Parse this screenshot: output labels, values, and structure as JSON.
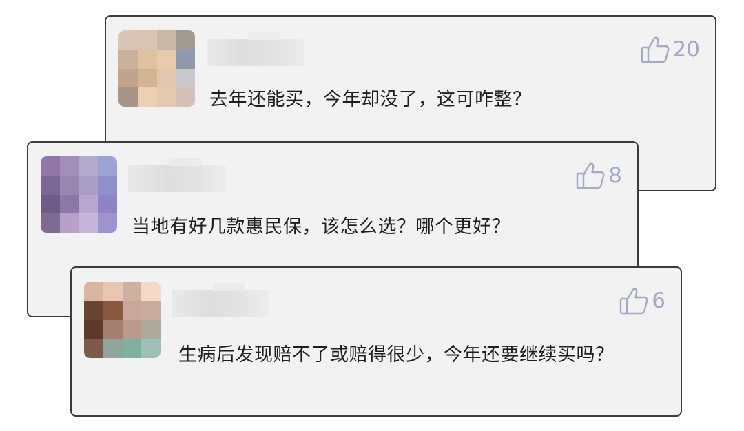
{
  "comments": [
    {
      "likes": "20",
      "text": "去年还能买，今年却没了，这可咋整？",
      "avatar_colors": [
        "#d8c6b6",
        "#d9c5b2",
        "#c8b9a6",
        "#a29a90",
        "#cbb09a",
        "#e2c19e",
        "#e7cba9",
        "#8f99ad",
        "#c3a48b",
        "#d2b393",
        "#e0c7ab",
        "#c9c9cf",
        "#a69487",
        "#e9d1b1",
        "#e2c8ae",
        "#d4c2b8"
      ]
    },
    {
      "likes": "8",
      "text": "当地有好几款惠民保，该怎么选？哪个更好？",
      "avatar_colors": [
        "#8f78a8",
        "#a28fb9",
        "#b4a9c8",
        "#9ea3d6",
        "#7c6696",
        "#9a84b0",
        "#aa9ec4",
        "#8d8fcb",
        "#6f5b88",
        "#8b78a6",
        "#b8a6cf",
        "#8c84c6",
        "#7e6a92",
        "#b89fc8",
        "#c6b4d6",
        "#9f93cb"
      ]
    },
    {
      "likes": "6",
      "text": "生病后发现赔不了或赔得很少，今年还要继续买吗？",
      "avatar_colors": [
        "#d9b5a0",
        "#e6c6b2",
        "#cdb2a3",
        "#f2d9c9",
        "#6a4430",
        "#8a5a40",
        "#c9a59a",
        "#c7aba0",
        "#5e3a2a",
        "#a28070",
        "#b99a8c",
        "#b1a89c",
        "#7e5b48",
        "#8fa59a",
        "#7fb1a0",
        "#9cc1b4"
      ]
    }
  ],
  "like_icon": "thumbs-up-icon"
}
